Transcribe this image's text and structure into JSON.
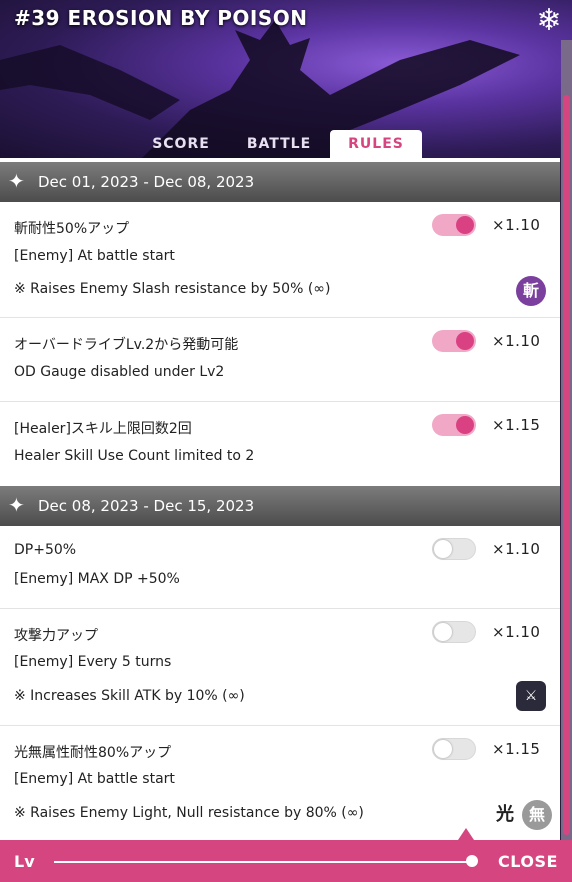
{
  "header": {
    "title": "#39 EROSION BY POISON"
  },
  "tabs": [
    {
      "label": "SCORE",
      "active": false
    },
    {
      "label": "BATTLE",
      "active": false
    },
    {
      "label": "RULES",
      "active": true
    }
  ],
  "sections": [
    {
      "date": "Dec 01, 2023 - Dec 08, 2023",
      "rules": [
        {
          "jp": "斬耐性50%アップ",
          "en": "[Enemy] At battle start",
          "note": "※ Raises Enemy Slash resistance by 50% (∞)",
          "enabled": true,
          "multiplier": "×1.10",
          "badges": [
            "斬"
          ]
        },
        {
          "jp": "オーバードライブLv.2から発動可能",
          "en": "OD Gauge disabled under Lv2",
          "note": "",
          "enabled": true,
          "multiplier": "×1.10",
          "badges": []
        },
        {
          "jp": "[Healer]スキル上限回数2回",
          "en": "Healer Skill Use Count limited to 2",
          "note": "",
          "enabled": true,
          "multiplier": "×1.15",
          "badges": []
        }
      ]
    },
    {
      "date": "Dec 08, 2023 - Dec 15, 2023",
      "rules": [
        {
          "jp": "DP+50%",
          "en": "[Enemy] MAX DP +50%",
          "note": "",
          "enabled": false,
          "multiplier": "×1.10",
          "badges": []
        },
        {
          "jp": "攻撃力アップ",
          "en": "[Enemy] Every 5 turns",
          "note": "※ Increases Skill ATK by 10% (∞)",
          "enabled": false,
          "multiplier": "×1.10",
          "badges": [
            "sword-up"
          ]
        },
        {
          "jp": "光無属性耐性80%アップ",
          "en": "[Enemy] At battle start",
          "note": "※ Raises Enemy Light, Null resistance by 80% (∞)",
          "enabled": false,
          "multiplier": "×1.15",
          "badges": [
            "光",
            "無"
          ]
        }
      ]
    }
  ],
  "footer": {
    "lv_label": "Lv",
    "close_label": "CLOSE",
    "slider_level": 1.0
  },
  "colors": {
    "accent": "#d5457f",
    "toggle_on": "#d94183",
    "toggle_track_on": "#f1a8c6",
    "slash_badge": "#7b3f9e"
  }
}
